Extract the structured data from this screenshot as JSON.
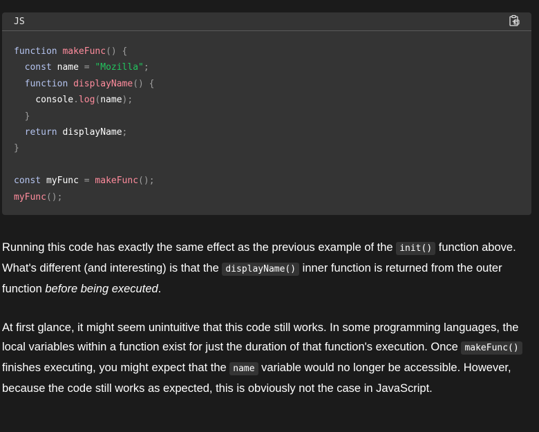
{
  "code_block": {
    "language_label": "JS",
    "copy_icon": "clipboard-copy-icon",
    "lines": [
      [
        {
          "t": "function",
          "c": "kw"
        },
        {
          "t": " "
        },
        {
          "t": "makeFunc",
          "c": "fn"
        },
        {
          "t": "() {",
          "c": "pn"
        }
      ],
      [
        {
          "t": "  "
        },
        {
          "t": "const",
          "c": "kw"
        },
        {
          "t": " name "
        },
        {
          "t": "=",
          "c": "pn"
        },
        {
          "t": " "
        },
        {
          "t": "\"Mozilla\"",
          "c": "str"
        },
        {
          "t": ";",
          "c": "pn"
        }
      ],
      [
        {
          "t": "  "
        },
        {
          "t": "function",
          "c": "kw"
        },
        {
          "t": " "
        },
        {
          "t": "displayName",
          "c": "fn"
        },
        {
          "t": "() {",
          "c": "pn"
        }
      ],
      [
        {
          "t": "    console"
        },
        {
          "t": ".",
          "c": "pn"
        },
        {
          "t": "log",
          "c": "fn"
        },
        {
          "t": "(",
          "c": "pn"
        },
        {
          "t": "name"
        },
        {
          "t": ");",
          "c": "pn"
        }
      ],
      [
        {
          "t": "  "
        },
        {
          "t": "}",
          "c": "pn"
        }
      ],
      [
        {
          "t": "  "
        },
        {
          "t": "return",
          "c": "kw"
        },
        {
          "t": " displayName"
        },
        {
          "t": ";",
          "c": "pn"
        }
      ],
      [
        {
          "t": "}",
          "c": "pn"
        }
      ],
      [],
      [
        {
          "t": "const",
          "c": "kw"
        },
        {
          "t": " myFunc "
        },
        {
          "t": "=",
          "c": "pn"
        },
        {
          "t": " "
        },
        {
          "t": "makeFunc",
          "c": "fn"
        },
        {
          "t": "();",
          "c": "pn"
        }
      ],
      [
        {
          "t": "myFunc",
          "c": "fn"
        },
        {
          "t": "();",
          "c": "pn"
        }
      ]
    ]
  },
  "paragraph1": {
    "part1": "Running this code has exactly the same effect as the previous example of the ",
    "code1": "init()",
    "part2": " function above. What's different (and interesting) is that the ",
    "code2": "displayName()",
    "part3": " inner function is returned from the outer function ",
    "emphasis": "before being executed",
    "part4": "."
  },
  "paragraph2": {
    "part1": "At first glance, it might seem unintuitive that this code still works. In some programming languages, the local variables within a function exist for just the duration of that function's execution. Once ",
    "code1": "makeFunc()",
    "part2": " finishes executing, you might expect that the ",
    "code2": "name",
    "part3": " variable would no longer be accessible. However, because the code still works as expected, this is obviously not the case in JavaScript."
  }
}
